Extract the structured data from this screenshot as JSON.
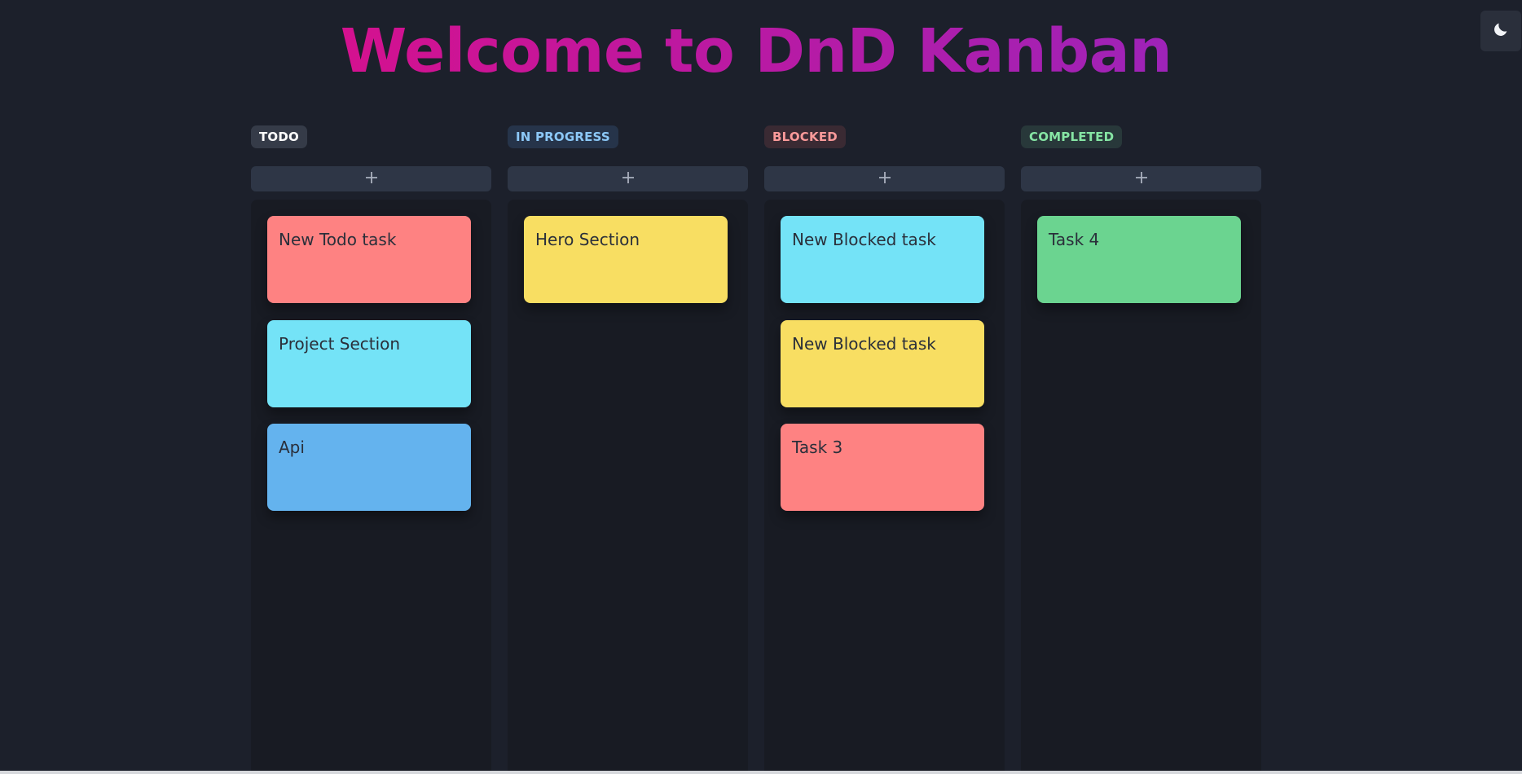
{
  "header": {
    "title": "Welcome to DnD Kanban",
    "gradient_start": "#d4118f",
    "gradient_end": "#9e23b8"
  },
  "theme_toggle": {
    "icon": "moon-icon"
  },
  "columns": [
    {
      "label": "TODO",
      "label_bg": "#353b48",
      "label_color": "#ffffff",
      "add_icon": "plus-icon",
      "cards": [
        {
          "title": "New Todo task",
          "color": "#fe8282"
        },
        {
          "title": "Project Section",
          "color": "#74e3f7"
        },
        {
          "title": "Api",
          "color": "#64b3ee"
        }
      ]
    },
    {
      "label": "IN PROGRESS",
      "label_bg": "#26344a",
      "label_color": "#8cc8f7",
      "add_icon": "plus-icon",
      "cards": [
        {
          "title": "Hero Section",
          "color": "#f8de62"
        }
      ]
    },
    {
      "label": "BLOCKED",
      "label_bg": "#3a2a33",
      "label_color": "#fb9a9a",
      "add_icon": "plus-icon",
      "cards": [
        {
          "title": "New Blocked task",
          "color": "#74e3f7"
        },
        {
          "title": "New Blocked task",
          "color": "#f8de62"
        },
        {
          "title": "Task 3",
          "color": "#fe8282"
        }
      ]
    },
    {
      "label": "COMPLETED",
      "label_bg": "#28383a",
      "label_color": "#86e5a4",
      "add_icon": "plus-icon",
      "cards": [
        {
          "title": "Task 4",
          "color": "#6bd490"
        }
      ]
    }
  ]
}
